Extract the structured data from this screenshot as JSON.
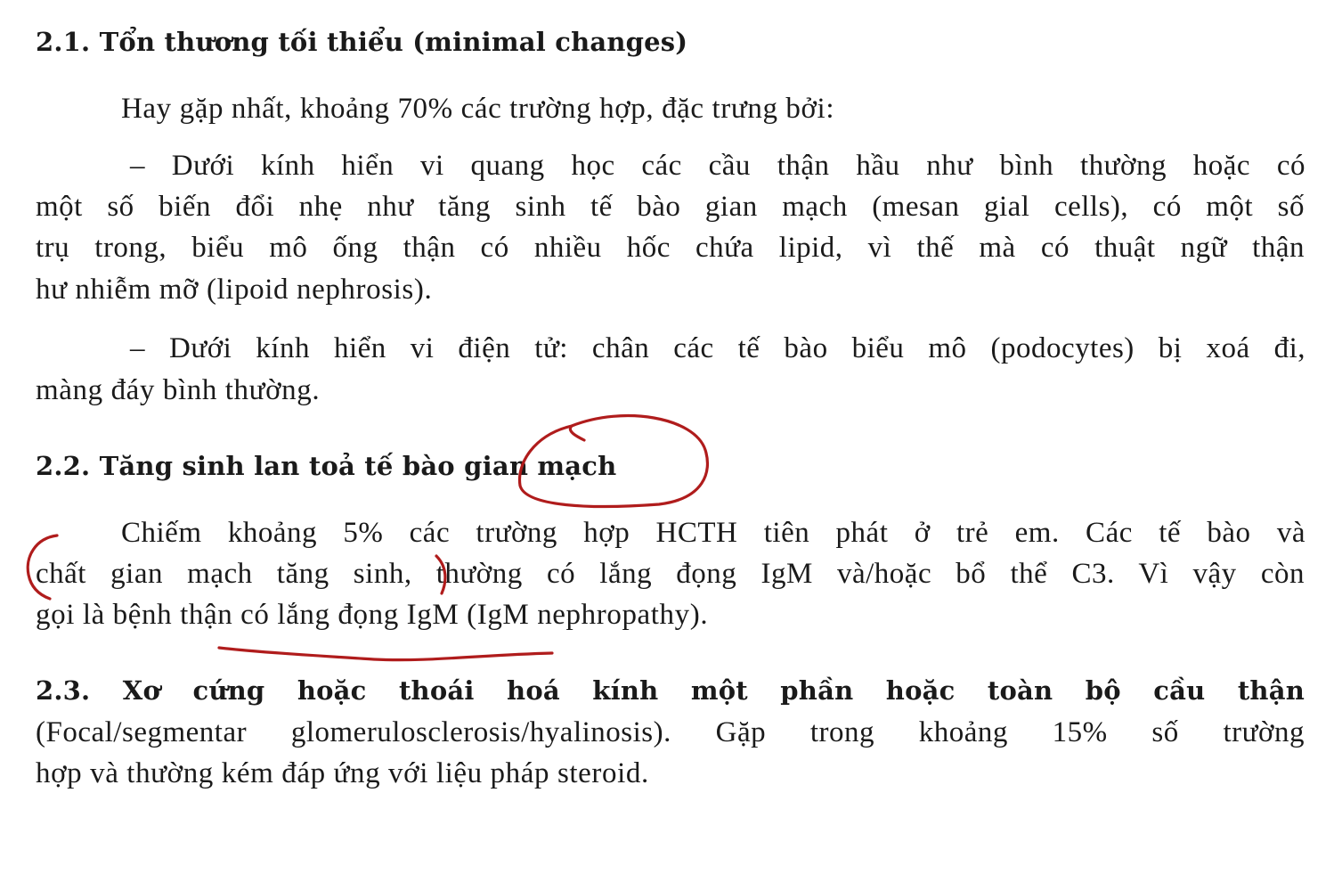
{
  "section_2_1": {
    "heading": "2.1. Tổn thương tối thiểu (minimal changes)",
    "intro": "Hay gặp nhất, khoảng 70% các trường hợp, đặc trưng bởi:",
    "bullet1_lines": [
      "–  Dưới kính hiển vi quang học các cầu thận hầu như bình thường hoặc có",
      "một số biến đổi nhẹ như tăng sinh tế bào gian mạch (mesan gial cells), có một số",
      "trụ trong, biểu mô ống thận có nhiều hốc chứa lipid, vì thế mà có thuật ngữ thận",
      "hư nhiễm mỡ (lipoid nephrosis)."
    ],
    "bullet2_lines": [
      "–  Dưới kính hiển vi điện tử: chân các tế bào biểu mô (podocytes) bị xoá  đi,",
      "màng đáy bình thường."
    ]
  },
  "section_2_2": {
    "heading": "2.2. Tăng sinh lan toả tế bào gian mạch",
    "lines": [
      "Chiếm khoảng 5% các trường hợp HCTH tiên phát ở trẻ em. Các tế bào và",
      "chất gian mạch tăng sinh, thường có lắng đọng IgM và/hoặc bổ thể C3. Vì vậy còn",
      "gọi là bệnh thận có lắng đọng IgM (IgM nephropathy)."
    ]
  },
  "section_2_3": {
    "heading_line": "2.3. Xơ cứng hoặc thoái hoá kính một phần hoặc toàn bộ cầu thận",
    "lines": [
      "(Focal/segmentar glomerulosclerosis/hyalinosis). Gặp trong khoảng 15% số trường",
      "hợp và thường kém đáp ứng với liệu pháp steroid."
    ]
  },
  "annotation_color": "#b01c1c"
}
